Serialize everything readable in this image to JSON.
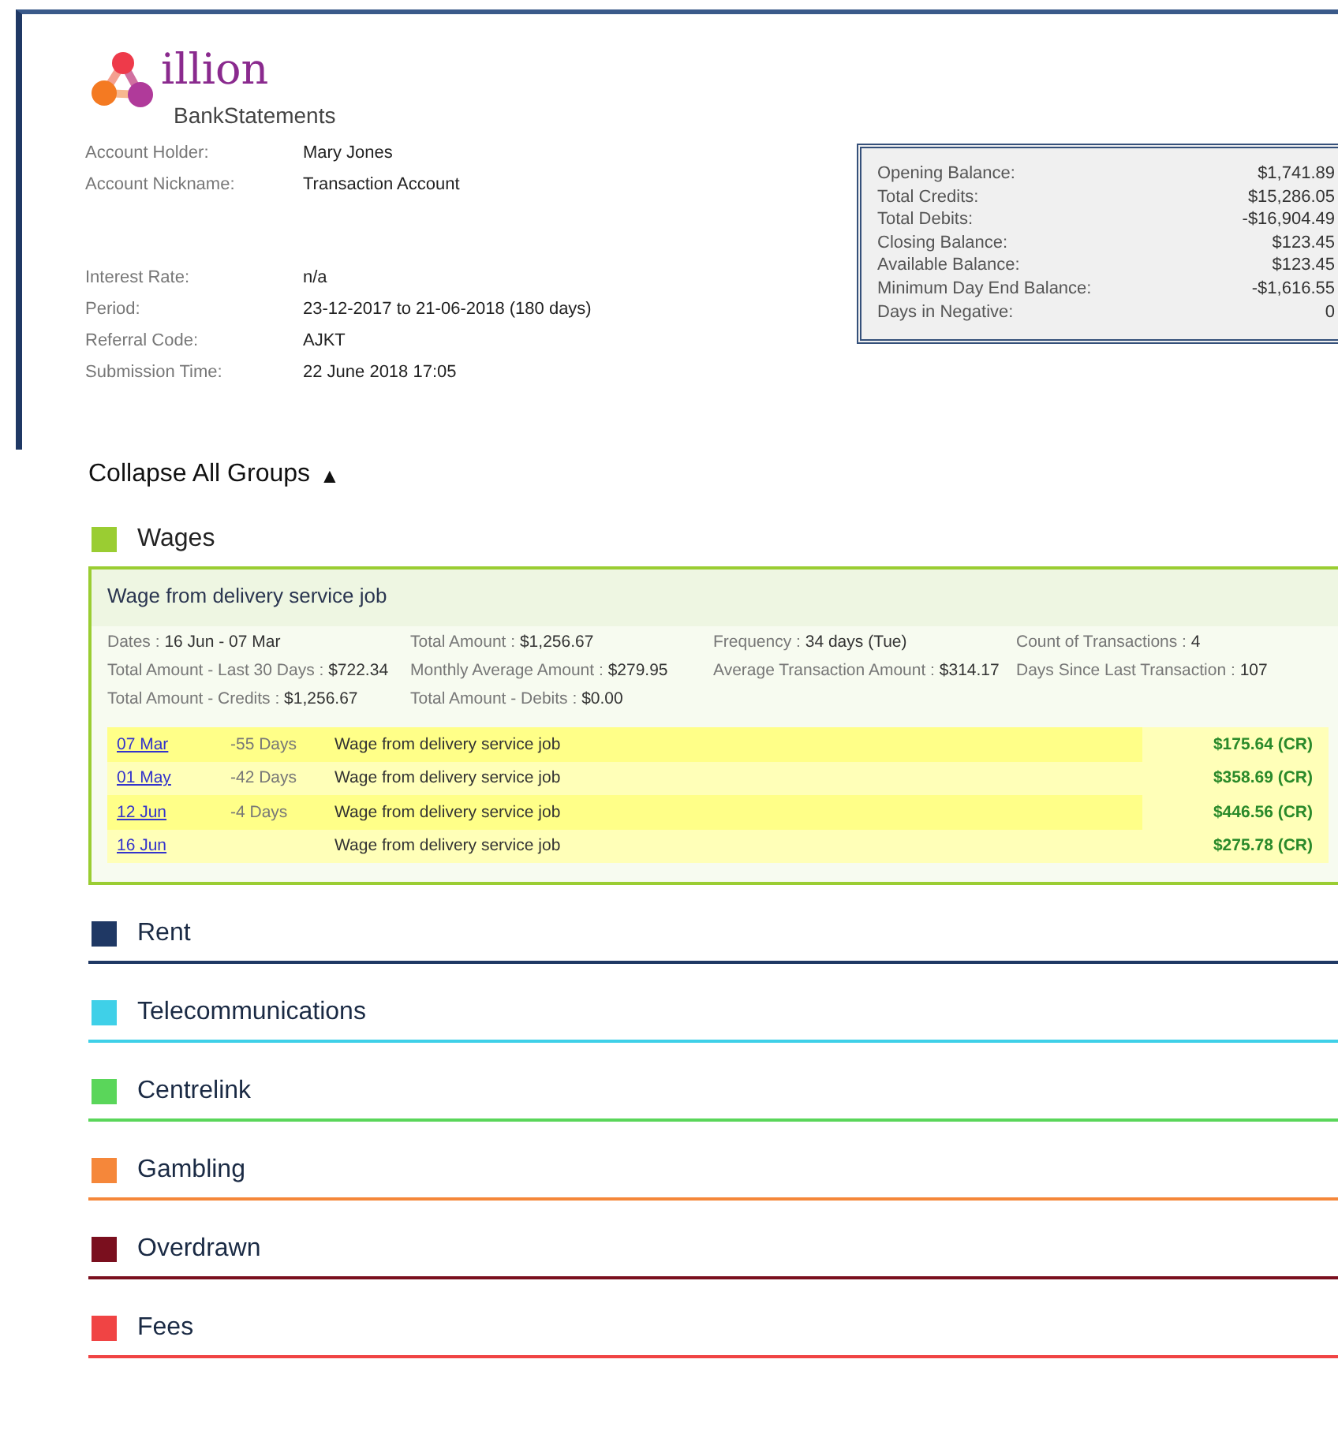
{
  "brand": {
    "name": "illion",
    "product": "BankStatements"
  },
  "account_details": [
    {
      "label": "Account Holder:",
      "value": "Mary Jones"
    },
    {
      "label": "Account Nickname:",
      "value": "Transaction Account"
    }
  ],
  "account_details_lower": [
    {
      "label": "Interest Rate:",
      "value": "n/a"
    },
    {
      "label": "Period:",
      "value": "23-12-2017 to 21-06-2018 (180 days)"
    },
    {
      "label": "Referral Code:",
      "value": "AJKT"
    },
    {
      "label": "Submission Time:",
      "value": "22 June 2018 17:05"
    }
  ],
  "summary": [
    {
      "label": "Opening Balance:",
      "value": "$1,741.89"
    },
    {
      "label": "Total Credits:",
      "value": "$15,286.05"
    },
    {
      "label": "Total Debits:",
      "value": "-$16,904.49"
    },
    {
      "label": "Closing Balance:",
      "value": "$123.45"
    },
    {
      "label": "Available Balance:",
      "value": "$123.45"
    },
    {
      "label": "Minimum Day End Balance:",
      "value": "-$1,616.55"
    },
    {
      "label": "Days in Negative:",
      "value": "0"
    }
  ],
  "collapse_all": {
    "label": "Collapse All Groups",
    "icon": "▲"
  },
  "groups": [
    {
      "name": "Wages",
      "color": "#9acd32",
      "expanded": true,
      "detail": {
        "title": "Wage from delivery service job",
        "stats": [
          {
            "label": "Dates :",
            "value": "16 Jun - 07 Mar"
          },
          {
            "label": "Total Amount :",
            "value": "$1,256.67"
          },
          {
            "label": "Frequency :",
            "value": "34 days (Tue)"
          },
          {
            "label": "Count of Transactions :",
            "value": "4"
          },
          {
            "label": "Total Amount - Last 30 Days :",
            "value": "$722.34"
          },
          {
            "label": "Monthly Average Amount :",
            "value": "$279.95"
          },
          {
            "label": "Average Transaction Amount :",
            "value": "$314.17"
          },
          {
            "label": "Days Since Last Transaction :",
            "value": "107"
          },
          {
            "label": "Total Amount - Credits :",
            "value": "$1,256.67"
          },
          {
            "label": "Total Amount - Debits :",
            "value": "$0.00"
          }
        ],
        "transactions": [
          {
            "date": "07 Mar",
            "days": "-55 Days",
            "description": "Wage from delivery service job",
            "amount": "$175.64 (CR)"
          },
          {
            "date": "01 May",
            "days": "-42 Days",
            "description": "Wage from delivery service job",
            "amount": "$358.69 (CR)"
          },
          {
            "date": "12 Jun",
            "days": "-4 Days",
            "description": "Wage from delivery service job",
            "amount": "$446.56 (CR)"
          },
          {
            "date": "16 Jun",
            "description": "Wage from delivery service job",
            "amount": "$275.78 (CR)"
          }
        ]
      }
    },
    {
      "name": "Rent",
      "color": "#1f3864",
      "expanded": false
    },
    {
      "name": "Telecommunications",
      "color": "#3fd0e8",
      "expanded": false
    },
    {
      "name": "Centrelink",
      "color": "#5ad65a",
      "expanded": false
    },
    {
      "name": "Gambling",
      "color": "#f5873a",
      "expanded": false
    },
    {
      "name": "Overdrawn",
      "color": "#7a0f1e",
      "expanded": false
    },
    {
      "name": "Fees",
      "color": "#f04444",
      "expanded": false
    }
  ]
}
